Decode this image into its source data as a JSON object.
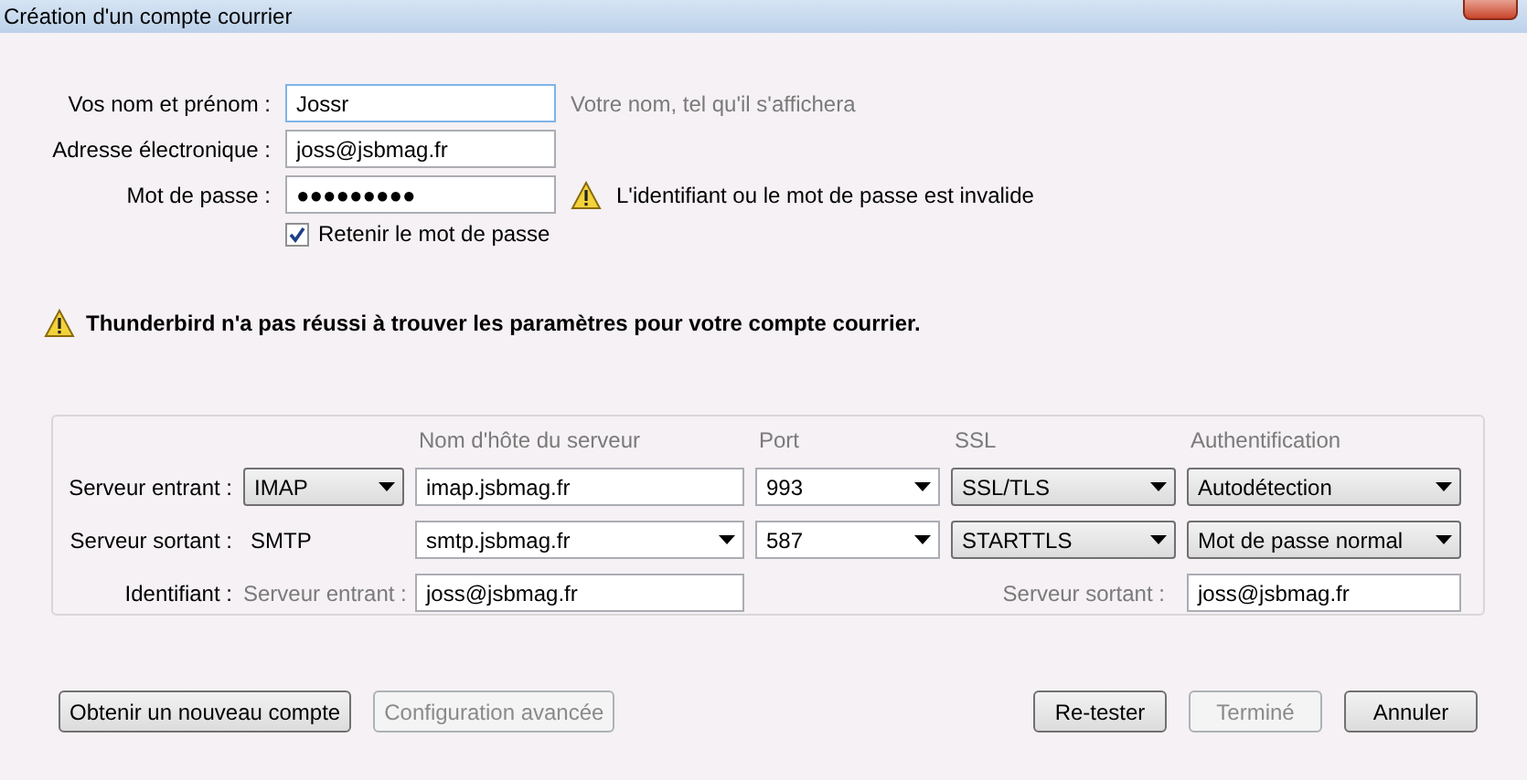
{
  "window": {
    "title": "Création d'un compte courrier"
  },
  "identity": {
    "fields": [
      {
        "label": "Vos nom et prénom :",
        "value": "Jossr",
        "focused": true,
        "hint": "Votre nom, tel qu'il s'affichera"
      },
      {
        "label": "Adresse électronique :",
        "value": "joss@jsbmag.fr",
        "focused": false
      },
      {
        "label": "Mot de passe :",
        "value": "●●●●●●●●●",
        "focused": false,
        "error": "L'identifiant ou le mot de passe est invalide"
      }
    ],
    "remember": {
      "label": "Retenir le mot de passe",
      "checked": true
    }
  },
  "alert": {
    "text": "Thunderbird n'a pas réussi à trouver les paramètres pour votre compte courrier."
  },
  "server_settings": {
    "columns": [
      "",
      "Nom d'hôte du serveur",
      "Port",
      "SSL",
      "Authentification"
    ],
    "rows": [
      {
        "label": "Serveur entrant :",
        "cells": [
          {
            "kind": "dropdown",
            "value": "IMAP"
          },
          {
            "kind": "field",
            "value": "imap.jsbmag.fr"
          },
          {
            "kind": "combo",
            "value": "993"
          },
          {
            "kind": "dropdown",
            "value": "SSL/TLS"
          },
          {
            "kind": "dropdown",
            "value": "Autodétection"
          }
        ]
      },
      {
        "label": "Serveur sortant :",
        "cells": [
          {
            "kind": "text",
            "value": "SMTP"
          },
          {
            "kind": "combo",
            "value": "smtp.jsbmag.fr"
          },
          {
            "kind": "combo",
            "value": "587"
          },
          {
            "kind": "dropdown",
            "value": "STARTTLS"
          },
          {
            "kind": "dropdown",
            "value": "Mot de passe normal"
          }
        ]
      },
      {
        "label": "Identifiant :",
        "cells": [
          {
            "kind": "hint",
            "value": "Serveur entrant :"
          },
          {
            "kind": "field",
            "value": "joss@jsbmag.fr"
          },
          {
            "kind": "empty"
          },
          {
            "kind": "hint",
            "value": "Serveur sortant :"
          },
          {
            "kind": "field",
            "value": "joss@jsbmag.fr"
          }
        ]
      }
    ]
  },
  "buttons_left": [
    {
      "label": "Obtenir un nouveau compte",
      "disabled": false
    },
    {
      "label": "Configuration avancée",
      "disabled": true
    }
  ],
  "buttons_right": [
    {
      "label": "Re-tester",
      "disabled": false
    },
    {
      "label": "Terminé",
      "disabled": true
    },
    {
      "label": "Annuler",
      "disabled": false
    }
  ]
}
